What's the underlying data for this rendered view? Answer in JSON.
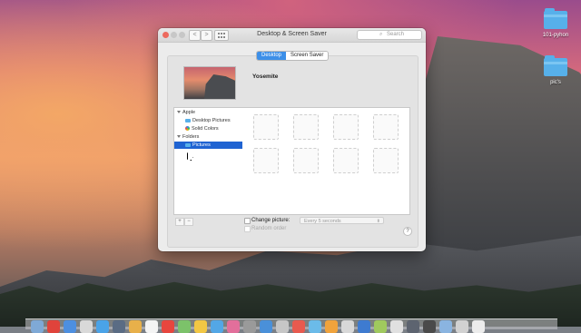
{
  "window": {
    "title": "Desktop & Screen Saver",
    "search_placeholder": "Search",
    "back_label": "<",
    "forward_label": ">"
  },
  "tabs": [
    {
      "label": "Desktop",
      "active": true
    },
    {
      "label": "Screen Saver",
      "active": false
    }
  ],
  "current_picture": {
    "name": "Yosemite"
  },
  "sidebar": {
    "groups": [
      {
        "label": "Apple",
        "items": [
          {
            "label": "Desktop Pictures",
            "icon": "folder-icon"
          },
          {
            "label": "Solid Colors",
            "icon": "color-wheel-icon"
          }
        ]
      },
      {
        "label": "Folders",
        "items": [
          {
            "label": "Pictures",
            "icon": "folder-icon",
            "selected": true
          }
        ]
      }
    ]
  },
  "grid_slots": 8,
  "controls": {
    "add_label": "+",
    "remove_label": "−",
    "change_picture_label": "Change picture:",
    "change_picture_checked": false,
    "interval_value": "Every 5 seconds",
    "random_order_label": "Random order",
    "random_order_checked": false,
    "help_label": "?"
  },
  "desktop_items": [
    {
      "label": "101-pyhon",
      "icon": "folder-icon"
    },
    {
      "label": "pic's",
      "icon": "folder-icon"
    }
  ],
  "colors": {
    "accent": "#3d8fe8",
    "selection": "#1f63d2",
    "folder": "#57b0ea",
    "close": "#ed6a5e"
  }
}
